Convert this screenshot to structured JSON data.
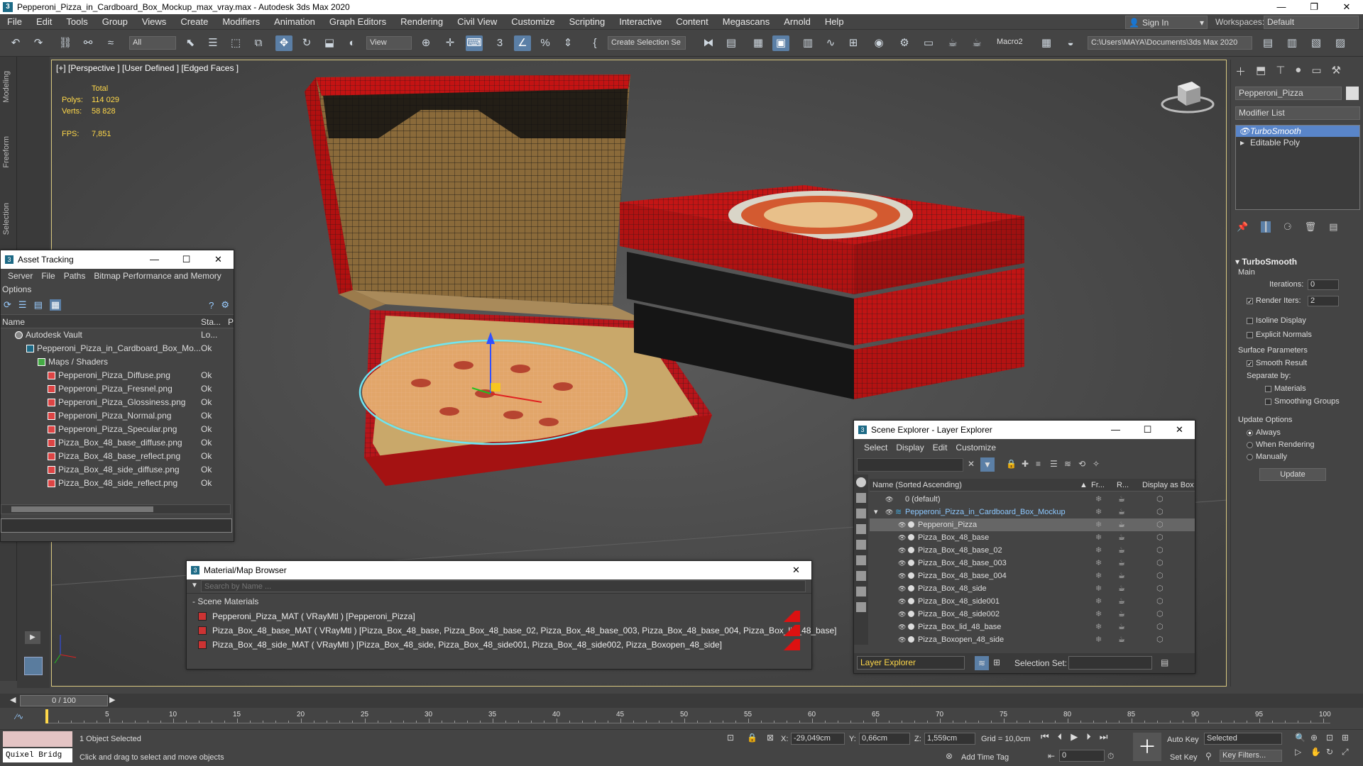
{
  "window": {
    "title": "Pepperoni_Pizza_in_Cardboard_Box_Mockup_max_vray.max - Autodesk 3ds Max 2020"
  },
  "menu": [
    "File",
    "Edit",
    "Tools",
    "Group",
    "Views",
    "Create",
    "Modifiers",
    "Animation",
    "Graph Editors",
    "Rendering",
    "Civil View",
    "Customize",
    "Scripting",
    "Interactive",
    "Content",
    "Megascans",
    "Arnold",
    "Help"
  ],
  "account": {
    "sign_in": "Sign In",
    "workspaces_label": "Workspaces:",
    "workspace": "Default"
  },
  "toolbar": {
    "filter": "All",
    "ref_coord": "View",
    "selection_set": "Create Selection Se",
    "macro": "Macro2",
    "project_path": "C:\\Users\\MAYA\\Documents\\3ds Max 2020"
  },
  "side_tabs": [
    "Modeling",
    "Freeform",
    "Selection"
  ],
  "viewport": {
    "label": "[+] [Perspective ] [User Defined ] [Edged Faces ]",
    "stats": {
      "total_label": "Total",
      "polys_label": "Polys:",
      "polys": "114 029",
      "verts_label": "Verts:",
      "verts": "58 828",
      "fps_label": "FPS:",
      "fps": "7,851"
    }
  },
  "command_panel": {
    "object_name": "Pepperoni_Pizza",
    "modifier_list": "Modifier List",
    "stack": [
      "TurboSmooth",
      "Editable Poly"
    ],
    "rollout_title": "TurboSmooth",
    "main_label": "Main",
    "iterations_label": "Iterations:",
    "iterations": "0",
    "render_iters_label": "Render Iters:",
    "render_iters": "2",
    "isoline": "Isoline Display",
    "explicit_normals": "Explicit Normals",
    "surface_params": "Surface Parameters",
    "smooth_result": "Smooth Result",
    "separate_by": "Separate by:",
    "materials": "Materials",
    "smoothing_groups": "Smoothing Groups",
    "update_options": "Update Options",
    "always": "Always",
    "when_rendering": "When Rendering",
    "manually": "Manually",
    "update_button": "Update"
  },
  "asset_tracking": {
    "title": "Asset Tracking",
    "menu": [
      "Server",
      "File",
      "Paths",
      "Bitmap Performance and Memory"
    ],
    "options": "Options",
    "col_name": "Name",
    "col_status": "Sta...",
    "col_p": "P",
    "rows": [
      {
        "name": "Autodesk Vault",
        "status": "Lo..."
      },
      {
        "name": "Pepperoni_Pizza_in_Cardboard_Box_Mo...",
        "status": "Ok"
      },
      {
        "name": "Maps / Shaders",
        "status": ""
      },
      {
        "name": "Pepperoni_Pizza_Diffuse.png",
        "status": "Ok"
      },
      {
        "name": "Pepperoni_Pizza_Fresnel.png",
        "status": "Ok"
      },
      {
        "name": "Pepperoni_Pizza_Glossiness.png",
        "status": "Ok"
      },
      {
        "name": "Pepperoni_Pizza_Normal.png",
        "status": "Ok"
      },
      {
        "name": "Pepperoni_Pizza_Specular.png",
        "status": "Ok"
      },
      {
        "name": "Pizza_Box_48_base_diffuse.png",
        "status": "Ok"
      },
      {
        "name": "Pizza_Box_48_base_reflect.png",
        "status": "Ok"
      },
      {
        "name": "Pizza_Box_48_side_diffuse.png",
        "status": "Ok"
      },
      {
        "name": "Pizza_Box_48_side_reflect.png",
        "status": "Ok"
      }
    ]
  },
  "scene_explorer": {
    "title": "Scene Explorer - Layer Explorer",
    "menu": [
      "Select",
      "Display",
      "Edit",
      "Customize"
    ],
    "col_name": "Name (Sorted Ascending)",
    "col_fr": "Fr...",
    "col_r": "R...",
    "col_box": "Display as Box",
    "rows": [
      {
        "name": "0 (default)",
        "level": 0
      },
      {
        "name": "Pepperoni_Pizza_in_Cardboard_Box_Mockup",
        "level": 1
      },
      {
        "name": "Pepperoni_Pizza",
        "level": 2
      },
      {
        "name": "Pizza_Box_48_base",
        "level": 2
      },
      {
        "name": "Pizza_Box_48_base_02",
        "level": 2
      },
      {
        "name": "Pizza_Box_48_base_003",
        "level": 2
      },
      {
        "name": "Pizza_Box_48_base_004",
        "level": 2
      },
      {
        "name": "Pizza_Box_48_side",
        "level": 2
      },
      {
        "name": "Pizza_Box_48_side001",
        "level": 2
      },
      {
        "name": "Pizza_Box_48_side002",
        "level": 2
      },
      {
        "name": "Pizza_Box_lid_48_base",
        "level": 2
      },
      {
        "name": "Pizza_Boxopen_48_side",
        "level": 2
      }
    ],
    "footer_explorer": "Layer Explorer",
    "selection_set_label": "Selection Set:"
  },
  "material_browser": {
    "title": "Material/Map Browser",
    "search_placeholder": "Search by Name ...",
    "section": "- Scene Materials",
    "rows": [
      "Pepperoni_Pizza_MAT  ( VRayMtl ) [Pepperoni_Pizza]",
      "Pizza_Box_48_base_MAT  ( VRayMtl ) [Pizza_Box_48_base, Pizza_Box_48_base_02, Pizza_Box_48_base_003, Pizza_Box_48_base_004, Pizza_Box_lid_48_base]",
      "Pizza_Box_48_side_MAT  ( VRayMtl ) [Pizza_Box_48_side, Pizza_Box_48_side001, Pizza_Box_48_side002, Pizza_Boxopen_48_side]"
    ]
  },
  "timeline": {
    "frame": "0 / 100",
    "ticks": [
      "5",
      "10",
      "15",
      "20",
      "25",
      "30",
      "35",
      "40",
      "45",
      "50",
      "55",
      "60",
      "65",
      "70",
      "75",
      "80",
      "85",
      "90",
      "95",
      "100"
    ]
  },
  "status_bar": {
    "maxscript": "Quixel Bridg",
    "selected": "1 Object Selected",
    "prompt": "Click and drag to select and move objects",
    "x_label": "X:",
    "x": "-29,049cm",
    "y_label": "Y:",
    "y": "0,66cm",
    "z_label": "Z:",
    "z": "1,559cm",
    "grid": "Grid = 10,0cm",
    "add_time_tag": "Add Time Tag",
    "auto_key": "Auto Key",
    "set_key": "Set Key",
    "key_mode": "Selected",
    "key_filters": "Key Filters...",
    "frame_field": "0"
  }
}
